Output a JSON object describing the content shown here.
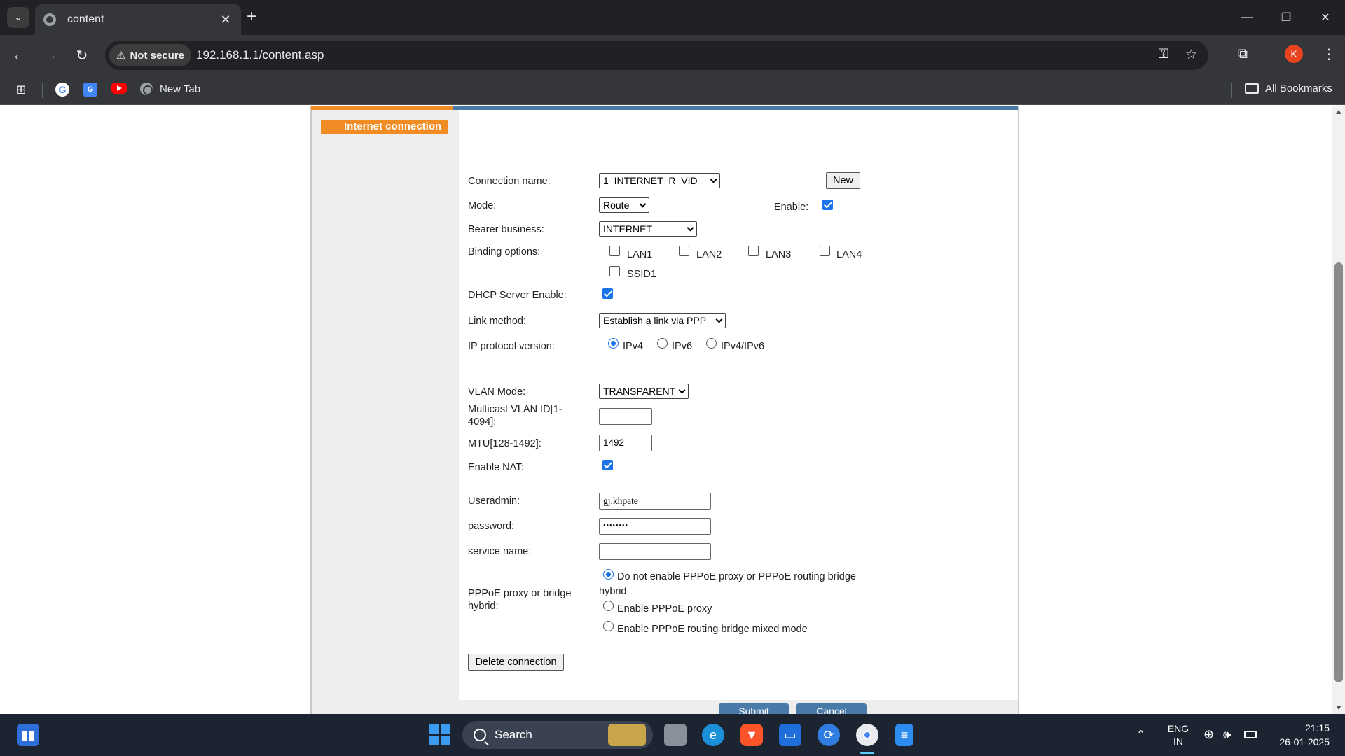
{
  "browser": {
    "tab_title": "content",
    "security_label": "Not secure",
    "url": "192.168.1.1/content.asp",
    "profile_initial": "K",
    "bookmarks": [
      {
        "label": ""
      },
      {
        "label": ""
      },
      {
        "label": ""
      },
      {
        "label": "New Tab"
      }
    ],
    "all_bookmarks_label": "All Bookmarks"
  },
  "page": {
    "section_tab": "Internet connection",
    "form": {
      "connection_name": {
        "label": "Connection name:",
        "value": "1_INTERNET_R_VID_",
        "new_button": "New"
      },
      "mode": {
        "label": "Mode:",
        "value": "Route",
        "enable_label": "Enable:",
        "enabled": true
      },
      "bearer": {
        "label": "Bearer business:",
        "value": "INTERNET"
      },
      "binding": {
        "label": "Binding options:",
        "options": [
          "LAN1",
          "LAN2",
          "LAN3",
          "LAN4",
          "SSID1"
        ]
      },
      "dhcp": {
        "label": "DHCP Server Enable:",
        "checked": true
      },
      "link_method": {
        "label": "Link method:",
        "value": "Establish a link via PPP"
      },
      "ip_version": {
        "label": "IP protocol version:",
        "options": [
          "IPv4",
          "IPv6",
          "IPv4/IPv6"
        ],
        "selected": "IPv4"
      },
      "vlan_mode": {
        "label": "VLAN Mode:",
        "value": "TRANSPARENT"
      },
      "multicast_vlan": {
        "label_line1": "Multicast VLAN ID[1-",
        "label_line2": "4094]:",
        "value": ""
      },
      "mtu": {
        "label": "MTU[128-1492]:",
        "value": "1492"
      },
      "nat": {
        "label": "Enable NAT:",
        "checked": true
      },
      "useradmin": {
        "label": "Useradmin:",
        "value": "gj.khpate"
      },
      "password": {
        "label": "password:",
        "value": "••••••••"
      },
      "service_name": {
        "label": "service name:",
        "value": ""
      },
      "pppoe": {
        "label_line1": "PPPoE proxy or bridge",
        "label_line2": "hybrid:",
        "opt1_line1": "Do not enable PPPoE proxy or PPPoE routing bridge",
        "opt1_line2": "hybrid",
        "opt2": "Enable PPPoE proxy",
        "opt3": "Enable PPPoE routing bridge mixed mode",
        "selected": 0
      },
      "delete_button": "Delete connection",
      "submit_button": "Submit",
      "cancel_button": "Cancel"
    }
  },
  "taskbar": {
    "search_placeholder": "Search",
    "language_line1": "ENG",
    "language_line2": "IN",
    "time": "21:15",
    "date": "26-01-2025"
  },
  "colors": {
    "accent_orange": "#f08c23",
    "accent_blue": "#4a7aa7",
    "checkbox_blue": "#1a73e8"
  }
}
